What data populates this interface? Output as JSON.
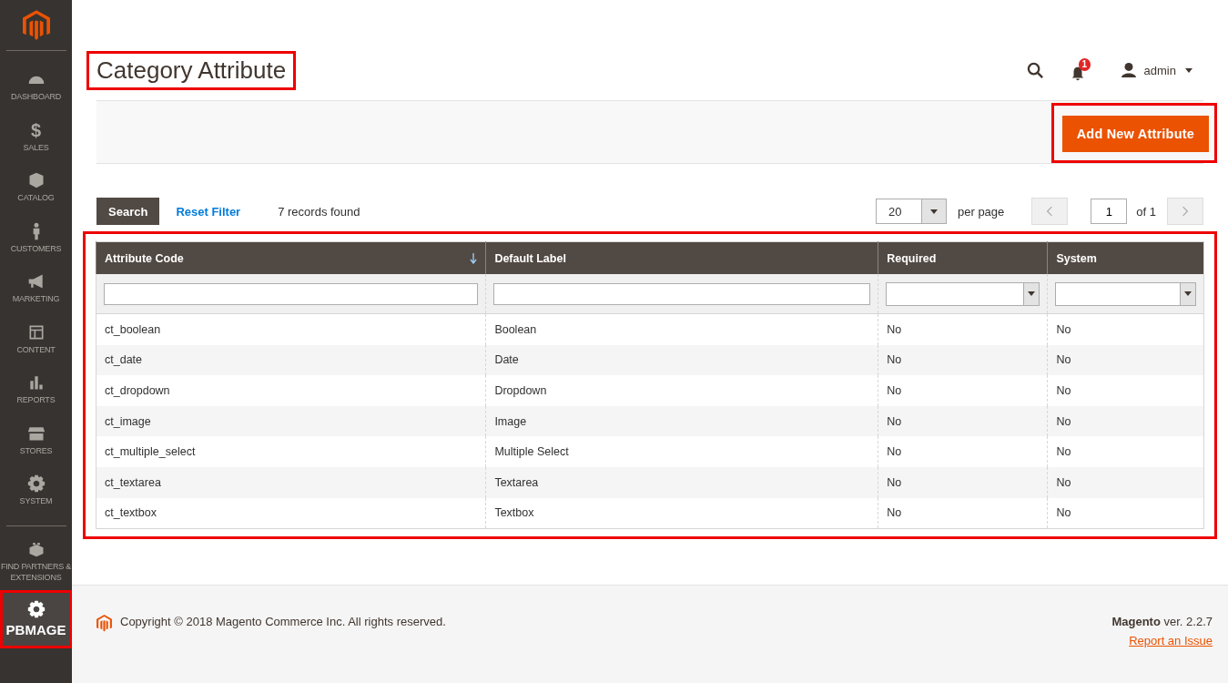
{
  "sidebar": {
    "items": [
      {
        "label": "DASHBOARD",
        "selected": false,
        "highlighted": false
      },
      {
        "label": "SALES",
        "glyph": "$",
        "selected": false,
        "highlighted": false
      },
      {
        "label": "CATALOG",
        "selected": false,
        "highlighted": false
      },
      {
        "label": "CUSTOMERS",
        "selected": false,
        "highlighted": false
      },
      {
        "label": "MARKETING",
        "selected": false,
        "highlighted": false
      },
      {
        "label": "CONTENT",
        "selected": false,
        "highlighted": false
      },
      {
        "label": "REPORTS",
        "selected": false,
        "highlighted": false
      },
      {
        "label": "STORES",
        "selected": false,
        "highlighted": false
      },
      {
        "label": "SYSTEM",
        "selected": false,
        "highlighted": false
      },
      {
        "label": "FIND PARTNERS & EXTENSIONS",
        "selected": false,
        "highlighted": false
      },
      {
        "label": "PBMAGE",
        "selected": true,
        "highlighted": true
      }
    ]
  },
  "page_title": {
    "text": "Category Attribute",
    "highlighted": true
  },
  "header": {
    "notifications": "1",
    "user": "admin"
  },
  "action_button": {
    "label": "Add New Attribute",
    "highlighted": true
  },
  "toolbar": {
    "search": "Search",
    "reset": "Reset Filter",
    "records": "7 records found",
    "page_size": "20",
    "per_page": "per page",
    "page": "1",
    "of": "of 1"
  },
  "grid": {
    "highlighted": true,
    "columns": [
      {
        "label": "Attribute Code",
        "sorted": true,
        "kind": "text"
      },
      {
        "label": "Default Label",
        "sorted": false,
        "kind": "text"
      },
      {
        "label": "Required",
        "sorted": false,
        "kind": "select"
      },
      {
        "label": "System",
        "sorted": false,
        "kind": "select"
      }
    ],
    "rows": [
      [
        "ct_boolean",
        "Boolean",
        "No",
        "No"
      ],
      [
        "ct_date",
        "Date",
        "No",
        "No"
      ],
      [
        "ct_dropdown",
        "Dropdown",
        "No",
        "No"
      ],
      [
        "ct_image",
        "Image",
        "No",
        "No"
      ],
      [
        "ct_multiple_select",
        "Multiple Select",
        "No",
        "No"
      ],
      [
        "ct_textarea",
        "Textarea",
        "No",
        "No"
      ],
      [
        "ct_textbox",
        "Textbox",
        "No",
        "No"
      ]
    ]
  },
  "footer": {
    "copyright": "Copyright © 2018 Magento Commerce Inc. All rights reserved.",
    "brand": "Magento",
    "version": "ver. 2.2.7",
    "report": "Report an Issue"
  }
}
